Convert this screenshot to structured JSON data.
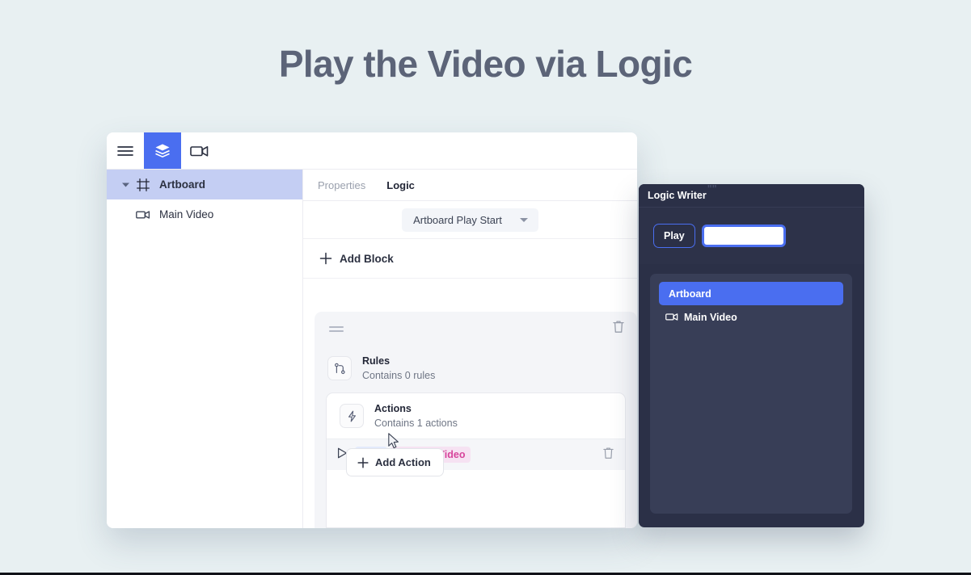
{
  "page": {
    "title": "Play the Video via Logic",
    "background_color": "#e8f0f2",
    "title_color": "#5c6478",
    "accent_color": "#4a6ef0"
  },
  "app_window": {
    "toolbar": {
      "buttons": [
        {
          "name": "menu-icon",
          "label": "Menu",
          "active": false
        },
        {
          "name": "layers-icon",
          "label": "Layers",
          "active": true
        },
        {
          "name": "video-icon",
          "label": "Video",
          "active": false
        }
      ]
    },
    "sidebar": {
      "layers": [
        {
          "label": "Artboard",
          "icon": "artboard-icon",
          "selected": true,
          "has_caret": true
        },
        {
          "label": "Main Video",
          "icon": "video-icon",
          "selected": false,
          "has_caret": false
        }
      ]
    },
    "right_pane": {
      "tabs": [
        {
          "label": "Properties",
          "active": false
        },
        {
          "label": "Logic",
          "active": true
        }
      ],
      "trigger_select": {
        "value": "Artboard Play Start"
      },
      "add_block": {
        "label": "Add Block"
      },
      "block": {
        "rules": {
          "title": "Rules",
          "subtitle": "Contains 0 rules",
          "icon": "rules-branch-icon"
        },
        "actions": {
          "title": "Actions",
          "subtitle": "Contains 1 actions",
          "icon": "lightning-icon"
        },
        "action_row": {
          "verb": "Play",
          "target": "Main Video",
          "verb_color": "#4a6ef0",
          "target_color": "#d7449b"
        },
        "add_action": {
          "label": "Add Action"
        }
      }
    }
  },
  "logic_writer": {
    "title": "Logic Writer",
    "title_mark": "\"\"",
    "expression": {
      "verb": "Play",
      "input_value": "",
      "input_placeholder": ""
    },
    "options": [
      {
        "label": "Artboard",
        "icon": "",
        "selected": true
      },
      {
        "label": "Main Video",
        "icon": "video-icon",
        "selected": false
      }
    ]
  }
}
